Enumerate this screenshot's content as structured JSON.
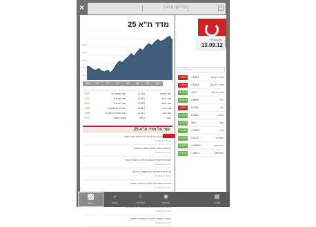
{
  "header": {
    "title": "מדדים ומניות"
  },
  "main": {
    "title": "מדד ת\"א 25",
    "y_labels": [
      "1140",
      "1130",
      "1120",
      "1110",
      "1100",
      "1090"
    ],
    "tabs": [
      "MAX",
      "5Y",
      "3Y",
      "1Y",
      "6M",
      "3M",
      "1M",
      "1W",
      "1D"
    ],
    "stats": [
      {
        "k": "שער פתיחה",
        "v": "1,131.5",
        "k2": "% שינוי תשואה",
        "v2": "+1.67"
      },
      {
        "k": "שער נעילה",
        "v": "1,133.1",
        "k2": "% שינוי שבוע",
        "v2": "+4.01"
      },
      {
        "k": "שער בסיס",
        "v": "1,133.3",
        "k2": "% שינוי חודש",
        "v2": "+6.12"
      },
      {
        "k": "שער גבוה",
        "v": "1,144.3",
        "k2": "% שינוי 12 חודשים",
        "v2": "+8.25"
      },
      {
        "k": "שער נמוך",
        "v": "1,121.1",
        "k2": "% שינוי מתחילת השנה",
        "v2": "+5.85"
      },
      {
        "k": "מחזור",
        "v": "490.4",
        "k2": "מחזור ממוצע",
        "v2": "+3.14"
      }
    ],
    "news_header": "עוד על מדד ת\"א 25",
    "news": [
      {
        "h": "ירידות בנעילה בת\"א; מניית לבינסקי-עופר זינקה",
        "d": "13/09/2012 17:30"
      },
      {
        "h": "הבורסה בת\"א ננעלה במגמה מעורבת",
        "d": "13/09/2012 17:19"
      },
      {
        "h": "המניות הדואליות נסחרות בפער מהארביטראז'",
        "d": "13/09/2012 16:05"
      },
      {
        "h": "מניית טבע מובילה את המסחר בבורסה",
        "d": "13/09/2012 15:42"
      },
      {
        "h": "המדדים המובילים עולים בפתיחת המסחר",
        "d": "13/09/2012 10:12"
      },
      {
        "h": "אנליסטים: הבורסה בת\"א צפויה להמשיך לעלות",
        "d": "12/09/2012 17:35"
      },
      {
        "h": "נעילה: עליות בבורסה בת\"א; מדד ת\"א 25 עלה",
        "d": "12/09/2012 17:28"
      },
      {
        "h": "הלוואי: המגמה החיובית ממשיכה במסחר",
        "d": "12/09/2012 12:10"
      }
    ]
  },
  "sidebar": {
    "day": "Thursday",
    "date": "13.09.12",
    "select": "ת\"א 25",
    "markets": [
      {
        "name": "מדד ת\"א 25",
        "val": "1,133.1",
        "chg": "-0.14%",
        "up": false
      },
      {
        "name": "מדד ת\"א 100",
        "val": "1,009.8",
        "chg": "-0.16%",
        "up": false
      },
      {
        "name": "מדד יתר 50",
        "val": "423.7",
        "chg": "+0.22%",
        "up": true
      },
      {
        "name": "דולר",
        "val": "3.9600",
        "chg": "+0.61%",
        "up": true
      },
      {
        "name": "יורו",
        "val": "5.1010",
        "chg": "-0.18%",
        "up": false
      },
      {
        "name": "ליש\"ט",
        "val": "6.3954",
        "chg": "+0.20%",
        "up": true
      },
      {
        "name": "נפט",
        "val": "96.8",
        "chg": "+0.37%",
        "up": true
      },
      {
        "name": "זהב",
        "val": "1,736.5",
        "chg": "+1.1%",
        "up": true
      },
      {
        "name": "נאסד\"ק",
        "val": "3,114.0",
        "chg": "+1.02%",
        "up": true
      },
      {
        "name": "דאו ג'ונס",
        "val": "13,539.9",
        "chg": "+1.55%",
        "up": true
      },
      {
        "name": "S&P 500",
        "val": "1,459.9",
        "chg": "+1.63%",
        "up": true
      }
    ]
  },
  "bottom_nav": [
    {
      "label": "תפריט",
      "icon": "grid-icon"
    },
    {
      "label": "גרפים",
      "icon": "chart-icon"
    },
    {
      "label": "עדכונים",
      "icon": "rss-icon"
    },
    {
      "label": "מועדפים",
      "icon": "star-icon"
    },
    {
      "label": "חיפוש",
      "icon": "search-icon"
    },
    {
      "label": "עוד",
      "icon": "info-icon"
    }
  ],
  "chart_data": {
    "type": "area",
    "title": "מדד ת\"א 25",
    "ylim": [
      1085,
      1145
    ],
    "values": [
      1102,
      1101,
      1098,
      1097,
      1099,
      1096,
      1095,
      1097,
      1094,
      1098,
      1104,
      1108,
      1106,
      1110,
      1113,
      1117,
      1114,
      1119,
      1123,
      1121,
      1126,
      1129,
      1127,
      1131,
      1134,
      1132,
      1133,
      1136,
      1138,
      1133
    ]
  }
}
